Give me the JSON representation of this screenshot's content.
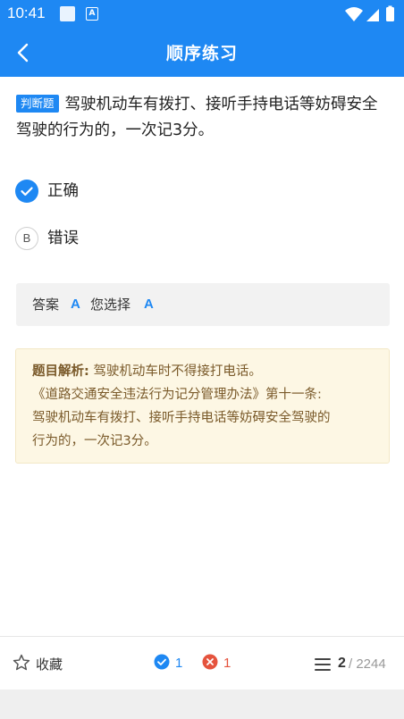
{
  "status_bar": {
    "time": "10:41",
    "icons": [
      "notification-square-icon",
      "app-a-icon",
      "wifi-icon",
      "signal-icon",
      "battery-icon"
    ]
  },
  "app_bar": {
    "title": "顺序练习",
    "back_icon": "chevron-left-icon"
  },
  "question": {
    "type_tag": "判断题",
    "text": "驾驶机动车有拨打、接听手持电话等妨碍安全驾驶的行为的，一次记3分。"
  },
  "options": [
    {
      "letter": "A",
      "label": "正确",
      "selected": true
    },
    {
      "letter": "B",
      "label": "错误",
      "selected": false
    }
  ],
  "answer": {
    "answer_label": "答案",
    "answer_value": "A",
    "chosen_label": "您选择",
    "chosen_value": "A"
  },
  "analysis": {
    "heading": "题目解析:",
    "line1": "驾驶机动车时不得接打电话。",
    "line2": "《道路交通安全违法行为记分管理办法》第十一条:",
    "line3": "驾驶机动车有拨打、接听手持电话等妨碍安全驾驶的",
    "line4": "行为的，一次记3分。"
  },
  "bottom_bar": {
    "favorite_label": "收藏",
    "correct_count": "1",
    "wrong_count": "1",
    "current_index": "2",
    "total": "/ 2244"
  },
  "colors": {
    "primary": "#1e88f3",
    "wrong": "#e5533d",
    "analysis_bg": "#fdf7e4",
    "analysis_text": "#7a5a2a"
  }
}
